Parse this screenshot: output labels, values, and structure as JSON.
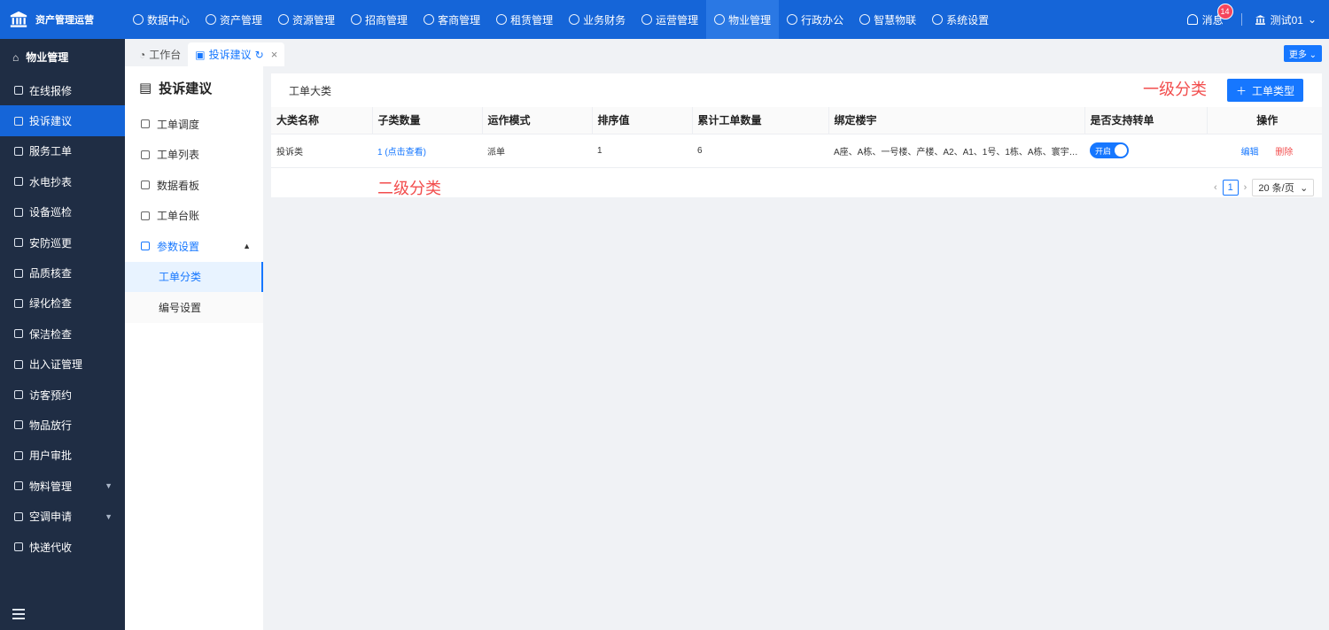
{
  "app": {
    "name": "资产管理运营"
  },
  "topnav": {
    "items": [
      "数据中心",
      "资产管理",
      "资源管理",
      "招商管理",
      "客商管理",
      "租赁管理",
      "业务财务",
      "运营管理",
      "物业管理",
      "行政办公",
      "智慧物联",
      "系统设置"
    ],
    "active_index": 8
  },
  "header": {
    "messages_label": "消息",
    "messages_count": "14",
    "user_name": "测试01"
  },
  "sidebar": {
    "title": "物业管理",
    "items": [
      "在线报修",
      "投诉建议",
      "服务工单",
      "水电抄表",
      "设备巡检",
      "安防巡更",
      "品质核查",
      "绿化检查",
      "保洁检查",
      "出入证管理",
      "访客预约",
      "物品放行",
      "用户审批",
      "物料管理",
      "空调申请",
      "快递代收"
    ],
    "active_index": 1
  },
  "tabs": {
    "items": [
      "工作台",
      "投诉建议"
    ],
    "active_index": 1,
    "more_label": "更多"
  },
  "submenu": {
    "title": "投诉建议",
    "items": [
      "工单调度",
      "工单列表",
      "数据看板",
      "工单台账",
      "参数设置"
    ],
    "children": [
      "工单分类",
      "编号设置"
    ],
    "active_child": 0
  },
  "card": {
    "title": "工单大类",
    "add_button": "工单类型",
    "annotation_level1": "一级分类",
    "annotation_level2": "二级分类"
  },
  "table": {
    "columns": [
      "大类名称",
      "子类数量",
      "运作模式",
      "排序值",
      "累计工单数量",
      "绑定楼宇",
      "是否支持转单",
      "操作"
    ],
    "rows": [
      {
        "name": "投诉类",
        "sub_count": "1 (点击查看)",
        "mode": "派单",
        "sort": "1",
        "total": "6",
        "buildings": "A座、A栋、一号楼、产楼、A2、A1、1号、1栋、A栋、寰宇大厦...",
        "transfer": "开启",
        "edit": "编辑",
        "delete": "删除"
      }
    ]
  },
  "pagination": {
    "current_page": "1",
    "page_size": "20 条/页"
  },
  "colors": {
    "primary": "#1677ff",
    "topbar": "#1565d8",
    "sidebar": "#1f2d44",
    "danger": "#f24d4d"
  }
}
